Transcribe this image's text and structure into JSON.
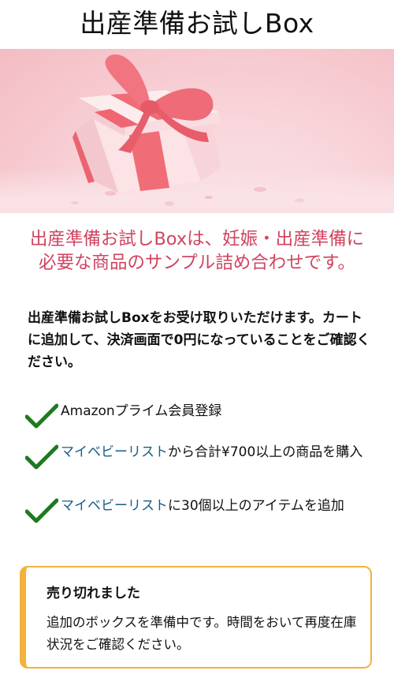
{
  "page": {
    "title": "出産準備お試しBox"
  },
  "tagline": {
    "line1": "出産準備お試しBoxは、妊娠・出産準備に",
    "line2": "必要な商品のサンプル詰め合わせです。"
  },
  "intro": {
    "text": "出産準備お試しBoxをお受け取りいただけます。カートに追加して、決済画面で0円になっていることをご確認ください。"
  },
  "requirements": [
    {
      "link": "",
      "text": "Amazonプライム会員登録"
    },
    {
      "link": "マイベビーリスト",
      "text": "から合計¥700以上の商品を購入"
    },
    {
      "link": "マイベビーリスト",
      "text": "に30個以上のアイテムを追加"
    }
  ],
  "soldout": {
    "heading": "売り切れました",
    "body": "追加のボックスを準備中です。時間をおいて再度在庫状況をご確認ください。"
  },
  "colors": {
    "accent_pink": "#d0445f",
    "link_blue": "#1a5c86",
    "check_green": "#1e7a1e",
    "alert_border": "#f4b13c"
  },
  "icons": {
    "check": "check-icon"
  }
}
